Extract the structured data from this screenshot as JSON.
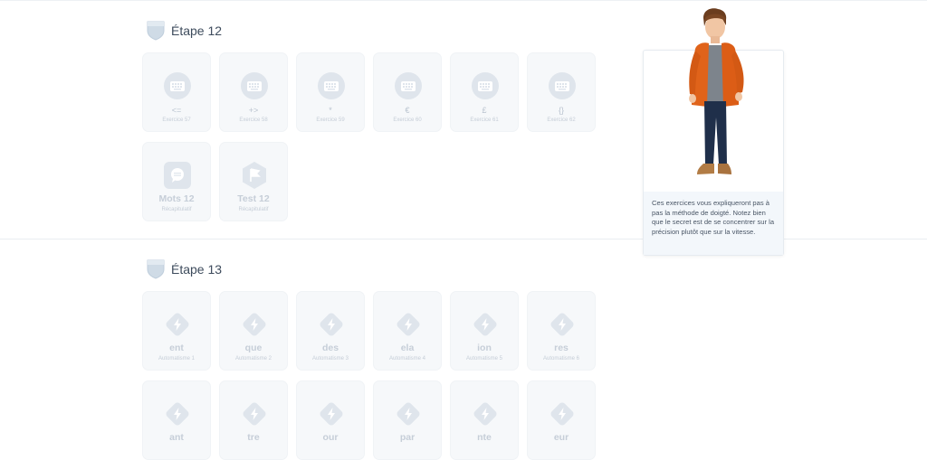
{
  "steps": [
    {
      "title": "Étape 12",
      "cards": [
        {
          "label": "<=",
          "sub": "Exercice 57",
          "icon": "keyboard-icon"
        },
        {
          "label": "+>",
          "sub": "Exercice 58",
          "icon": "keyboard-icon"
        },
        {
          "label": "*",
          "sub": "Exercice 59",
          "icon": "keyboard-icon"
        },
        {
          "label": "€",
          "sub": "Exercice 60",
          "icon": "keyboard-icon"
        },
        {
          "label": "£",
          "sub": "Exercice 61",
          "icon": "keyboard-icon"
        },
        {
          "label": "{}",
          "sub": "Exercice 62",
          "icon": "keyboard-icon"
        },
        {
          "label": "Mots 12",
          "sub": "Récapitulatif",
          "icon": "speech-bubble-icon"
        },
        {
          "label": "Test 12",
          "sub": "Récapitulatif",
          "icon": "flag-icon"
        }
      ]
    },
    {
      "title": "Étape 13",
      "cards": [
        {
          "label": "ent",
          "sub": "Automatisme 1",
          "icon": "lightning-icon"
        },
        {
          "label": "que",
          "sub": "Automatisme 2",
          "icon": "lightning-icon"
        },
        {
          "label": "des",
          "sub": "Automatisme 3",
          "icon": "lightning-icon"
        },
        {
          "label": "ela",
          "sub": "Automatisme 4",
          "icon": "lightning-icon"
        },
        {
          "label": "ion",
          "sub": "Automatisme 5",
          "icon": "lightning-icon"
        },
        {
          "label": "res",
          "sub": "Automatisme 6",
          "icon": "lightning-icon"
        },
        {
          "label": "ant",
          "sub": "",
          "icon": "lightning-icon"
        },
        {
          "label": "tre",
          "sub": "",
          "icon": "lightning-icon"
        },
        {
          "label": "our",
          "sub": "",
          "icon": "lightning-icon"
        },
        {
          "label": "par",
          "sub": "",
          "icon": "lightning-icon"
        },
        {
          "label": "nte",
          "sub": "",
          "icon": "lightning-icon"
        },
        {
          "label": "eur",
          "sub": "",
          "icon": "lightning-icon"
        }
      ]
    }
  ],
  "coach": {
    "message": "Ces exercices vous expliqueront pas à pas la méthode de doigté. Notez bien que le secret est de se concentrer sur la précision plutôt que sur la vitesse."
  },
  "colors": {
    "card_bg": "#f6f8fa",
    "icon_fill": "#dfe5ec",
    "shield": "#c9d6e3",
    "jacket": "#e0631a"
  }
}
